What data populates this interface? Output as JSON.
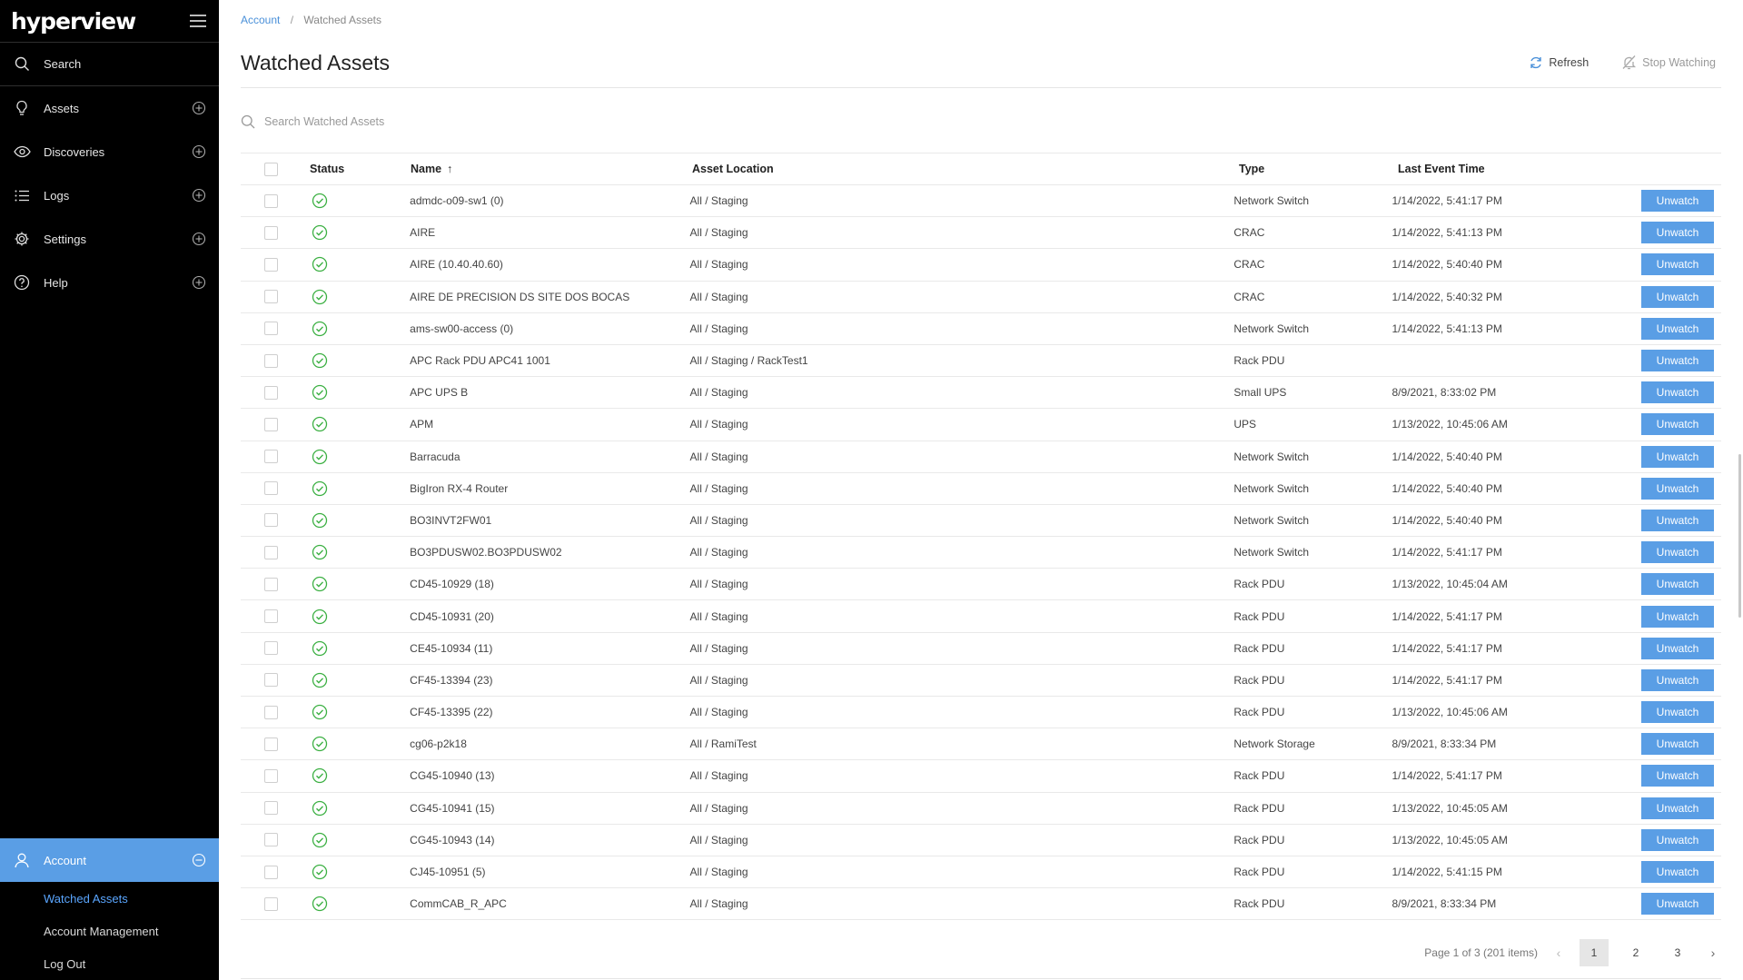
{
  "app": {
    "logo": "hyperview"
  },
  "sidebar": {
    "search_label": "Search",
    "items": [
      {
        "label": "Assets",
        "icon": "lightbulb-icon"
      },
      {
        "label": "Discoveries",
        "icon": "eye-icon"
      },
      {
        "label": "Logs",
        "icon": "list-icon"
      },
      {
        "label": "Settings",
        "icon": "gear-icon"
      },
      {
        "label": "Help",
        "icon": "help-icon"
      }
    ],
    "account": {
      "label": "Account",
      "sub_items": [
        {
          "label": "Watched Assets",
          "active": true
        },
        {
          "label": "Account Management",
          "active": false
        },
        {
          "label": "Log Out",
          "active": false
        }
      ]
    }
  },
  "breadcrumb": {
    "parent": "Account",
    "current": "Watched Assets"
  },
  "page": {
    "title": "Watched Assets",
    "refresh_label": "Refresh",
    "stop_watching_label": "Stop Watching",
    "search_placeholder": "Search Watched Assets"
  },
  "table": {
    "headers": {
      "status": "Status",
      "name": "Name",
      "location": "Asset Location",
      "type": "Type",
      "last_event": "Last Event Time"
    },
    "action_label": "Unwatch",
    "rows": [
      {
        "name": "admdc-o09-sw1 (0)",
        "location": "All / Staging",
        "type": "Network Switch",
        "time": "1/14/2022, 5:41:17 PM"
      },
      {
        "name": "AIRE",
        "location": "All / Staging",
        "type": "CRAC",
        "time": "1/14/2022, 5:41:13 PM"
      },
      {
        "name": "AIRE (10.40.40.60)",
        "location": "All / Staging",
        "type": "CRAC",
        "time": "1/14/2022, 5:40:40 PM"
      },
      {
        "name": "AIRE DE PRECISION DS SITE DOS BOCAS",
        "location": "All / Staging",
        "type": "CRAC",
        "time": "1/14/2022, 5:40:32 PM"
      },
      {
        "name": "ams-sw00-access (0)",
        "location": "All / Staging",
        "type": "Network Switch",
        "time": "1/14/2022, 5:41:13 PM"
      },
      {
        "name": "APC Rack PDU APC41 1001",
        "location": "All / Staging / RackTest1",
        "type": "Rack PDU",
        "time": ""
      },
      {
        "name": "APC UPS B",
        "location": "All / Staging",
        "type": "Small UPS",
        "time": "8/9/2021, 8:33:02 PM"
      },
      {
        "name": "APM",
        "location": "All / Staging",
        "type": "UPS",
        "time": "1/13/2022, 10:45:06 AM"
      },
      {
        "name": "Barracuda",
        "location": "All / Staging",
        "type": "Network Switch",
        "time": "1/14/2022, 5:40:40 PM"
      },
      {
        "name": "BigIron RX-4 Router",
        "location": "All / Staging",
        "type": "Network Switch",
        "time": "1/14/2022, 5:40:40 PM"
      },
      {
        "name": "BO3INVT2FW01",
        "location": "All / Staging",
        "type": "Network Switch",
        "time": "1/14/2022, 5:40:40 PM"
      },
      {
        "name": "BO3PDUSW02.BO3PDUSW02",
        "location": "All / Staging",
        "type": "Network Switch",
        "time": "1/14/2022, 5:41:17 PM"
      },
      {
        "name": "CD45-10929 (18)",
        "location": "All / Staging",
        "type": "Rack PDU",
        "time": "1/13/2022, 10:45:04 AM"
      },
      {
        "name": "CD45-10931 (20)",
        "location": "All / Staging",
        "type": "Rack PDU",
        "time": "1/14/2022, 5:41:17 PM"
      },
      {
        "name": "CE45-10934 (11)",
        "location": "All / Staging",
        "type": "Rack PDU",
        "time": "1/14/2022, 5:41:17 PM"
      },
      {
        "name": "CF45-13394 (23)",
        "location": "All / Staging",
        "type": "Rack PDU",
        "time": "1/14/2022, 5:41:17 PM"
      },
      {
        "name": "CF45-13395 (22)",
        "location": "All / Staging",
        "type": "Rack PDU",
        "time": "1/13/2022, 10:45:06 AM"
      },
      {
        "name": "cg06-p2k18",
        "location": "All / RamiTest",
        "type": "Network Storage",
        "time": "8/9/2021, 8:33:34 PM"
      },
      {
        "name": "CG45-10940 (13)",
        "location": "All / Staging",
        "type": "Rack PDU",
        "time": "1/14/2022, 5:41:17 PM"
      },
      {
        "name": "CG45-10941 (15)",
        "location": "All / Staging",
        "type": "Rack PDU",
        "time": "1/13/2022, 10:45:05 AM"
      },
      {
        "name": "CG45-10943 (14)",
        "location": "All / Staging",
        "type": "Rack PDU",
        "time": "1/13/2022, 10:45:05 AM"
      },
      {
        "name": "CJ45-10951 (5)",
        "location": "All / Staging",
        "type": "Rack PDU",
        "time": "1/14/2022, 5:41:15 PM"
      },
      {
        "name": "CommCAB_R_APC",
        "location": "All / Staging",
        "type": "Rack PDU",
        "time": "8/9/2021, 8:33:34 PM"
      }
    ]
  },
  "pagination": {
    "summary": "Page 1 of 3 (201 items)",
    "pages": [
      "1",
      "2",
      "3"
    ],
    "current": "1"
  },
  "colors": {
    "accent": "#5a9ee5",
    "sidebar_bg": "#000000",
    "status_ok": "#3cb043",
    "link": "#4a90d9"
  }
}
